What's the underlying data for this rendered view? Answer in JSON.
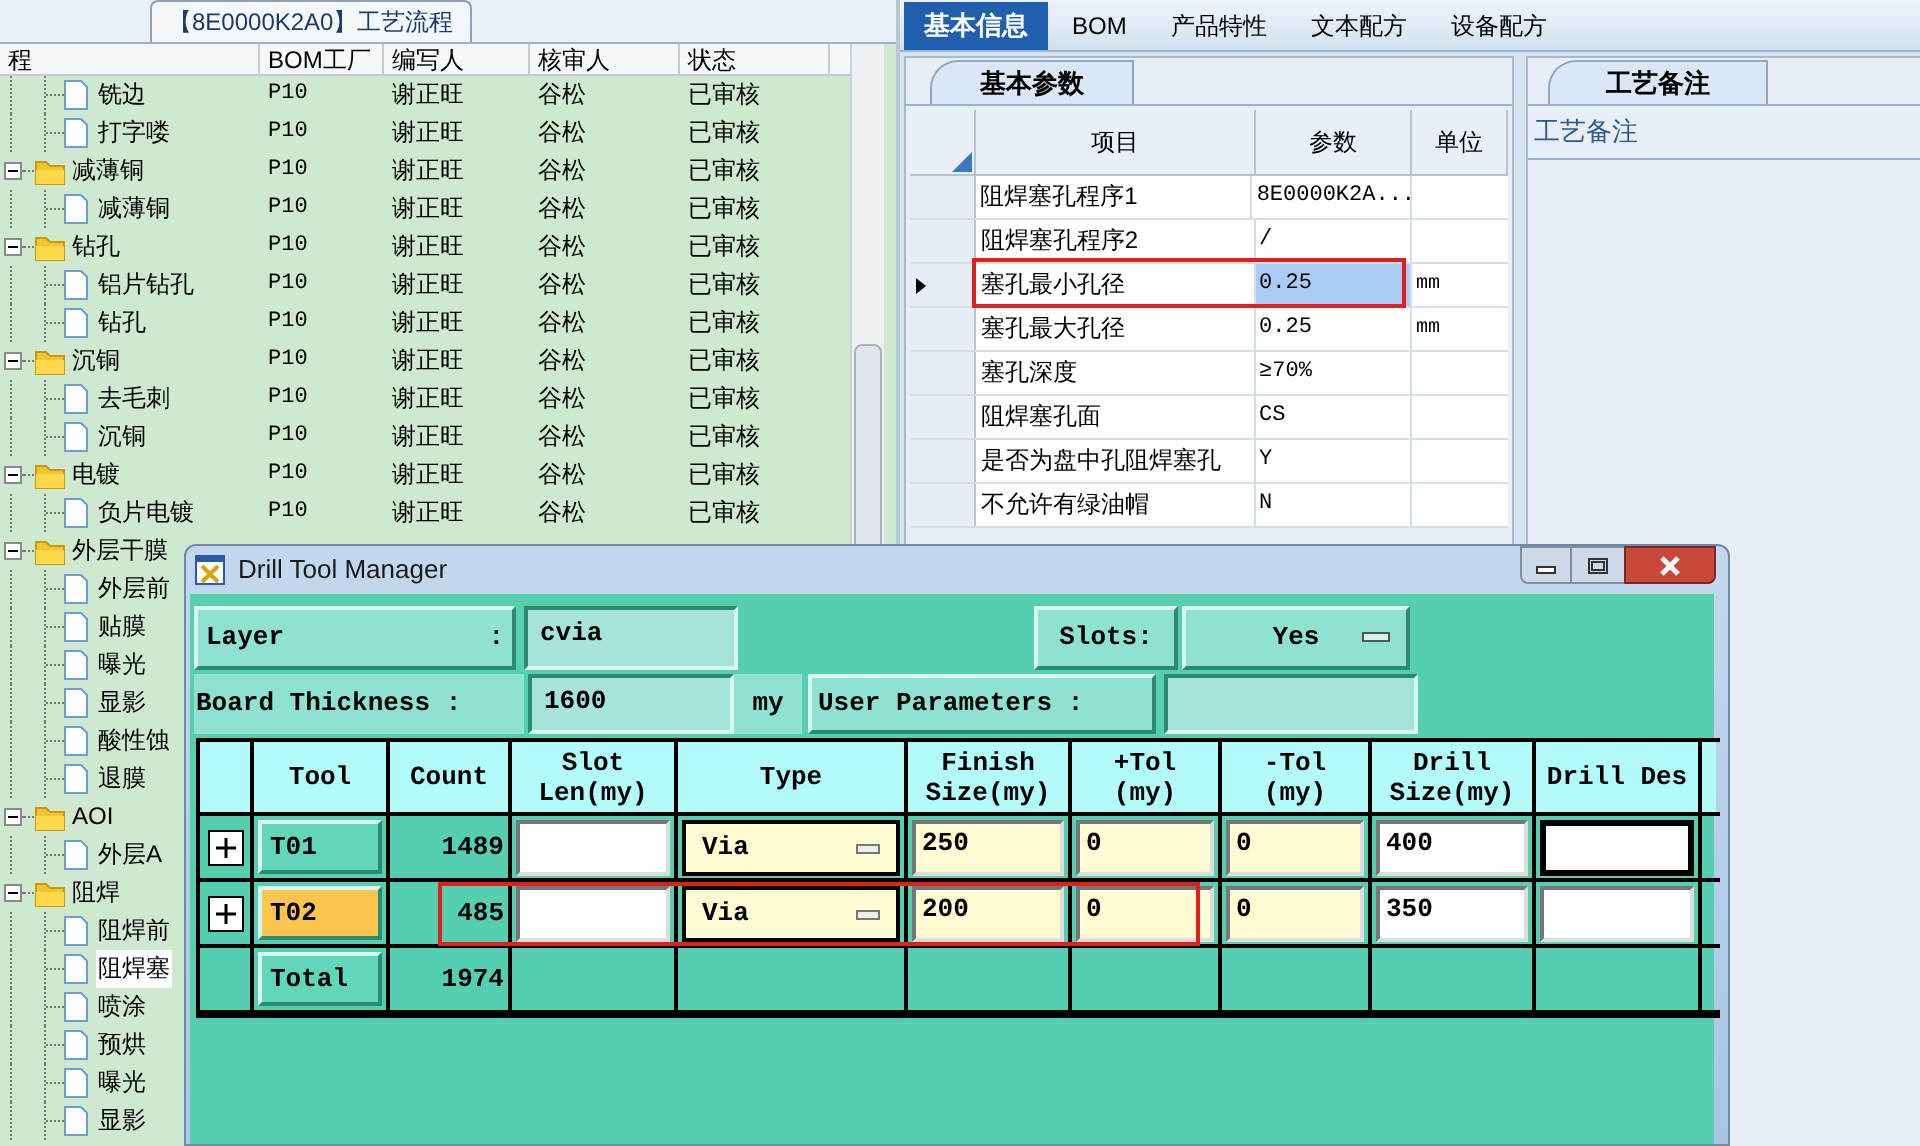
{
  "left_panel": {
    "tab": "【8E0000K2A0】工艺流程",
    "columns": [
      "程",
      "BOM工厂",
      "编写人",
      "核审人",
      "状态"
    ],
    "tree": [
      {
        "children": [
          {
            "name": "铣边",
            "bom": "P10",
            "writer": "谢正旺",
            "reviewer": "谷松",
            "status": "已审核",
            "selected": false
          },
          {
            "name": "打字喽",
            "bom": "P10",
            "writer": "谢正旺",
            "reviewer": "谷松",
            "status": "已审核",
            "selected": false
          }
        ]
      },
      {
        "name": "减薄铜",
        "bom": "P10",
        "writer": "谢正旺",
        "reviewer": "谷松",
        "status": "已审核",
        "selected": false,
        "expanded": true,
        "children": [
          {
            "name": "减薄铜",
            "bom": "P10",
            "writer": "谢正旺",
            "reviewer": "谷松",
            "status": "已审核",
            "selected": false
          }
        ]
      },
      {
        "name": "钻孔",
        "bom": "P10",
        "writer": "谢正旺",
        "reviewer": "谷松",
        "status": "已审核",
        "selected": false,
        "expanded": true,
        "children": [
          {
            "name": "铝片钻孔",
            "bom": "P10",
            "writer": "谢正旺",
            "reviewer": "谷松",
            "status": "已审核",
            "selected": false
          },
          {
            "name": "钻孔",
            "bom": "P10",
            "writer": "谢正旺",
            "reviewer": "谷松",
            "status": "已审核",
            "selected": false
          }
        ]
      },
      {
        "name": "沉铜",
        "bom": "P10",
        "writer": "谢正旺",
        "reviewer": "谷松",
        "status": "已审核",
        "selected": false,
        "expanded": true,
        "children": [
          {
            "name": "去毛刺",
            "bom": "P10",
            "writer": "谢正旺",
            "reviewer": "谷松",
            "status": "已审核",
            "selected": false
          },
          {
            "name": "沉铜",
            "bom": "P10",
            "writer": "谢正旺",
            "reviewer": "谷松",
            "status": "已审核",
            "selected": false
          }
        ]
      },
      {
        "name": "电镀",
        "bom": "P10",
        "writer": "谢正旺",
        "reviewer": "谷松",
        "status": "已审核",
        "selected": false,
        "expanded": true,
        "children": [
          {
            "name": "负片电镀",
            "bom": "P10",
            "writer": "谢正旺",
            "reviewer": "谷松",
            "status": "已审核",
            "selected": false
          }
        ]
      },
      {
        "name": "外层干膜",
        "selected": false,
        "expanded": true,
        "children": [
          {
            "name": "外层前",
            "selected": false
          },
          {
            "name": "贴膜",
            "selected": false
          },
          {
            "name": "曝光",
            "selected": false
          },
          {
            "name": "显影",
            "selected": false
          },
          {
            "name": "酸性蚀",
            "selected": false
          },
          {
            "name": "退膜",
            "selected": false
          }
        ]
      },
      {
        "name": "AOI",
        "selected": false,
        "expanded": true,
        "children": [
          {
            "name": "外层A",
            "selected": false
          }
        ]
      },
      {
        "name": "阻焊",
        "selected": false,
        "expanded": true,
        "children": [
          {
            "name": "阻焊前",
            "selected": false
          },
          {
            "name": "阻焊塞",
            "selected": true
          },
          {
            "name": "喷涂",
            "selected": false
          },
          {
            "name": "预烘",
            "selected": false
          },
          {
            "name": "曝光",
            "selected": false
          },
          {
            "name": "显影",
            "selected": false
          }
        ]
      }
    ]
  },
  "right_panel": {
    "tabs": [
      {
        "label": "基本信息",
        "selected": true
      },
      {
        "label": "BOM",
        "selected": false
      },
      {
        "label": "产品特性",
        "selected": false
      },
      {
        "label": "文本配方",
        "selected": false
      },
      {
        "label": "设备配方",
        "selected": false
      }
    ],
    "params_tab": "基本参数",
    "params_columns": [
      "项目",
      "参数",
      "单位"
    ],
    "params": [
      {
        "item": "阻焊塞孔程序1",
        "value": "8E0000K2A...",
        "current": false,
        "highlighted": false
      },
      {
        "item": "阻焊塞孔程序2",
        "value": "/",
        "current": false,
        "highlighted": false
      },
      {
        "item": "塞孔最小孔径",
        "value": "0.25",
        "unit": "mm",
        "current": true,
        "highlighted": true
      },
      {
        "item": "塞孔最大孔径",
        "value": "0.25",
        "unit": "mm",
        "current": false,
        "highlighted": false
      },
      {
        "item": "塞孔深度",
        "value": "≥70%",
        "current": false,
        "highlighted": false
      },
      {
        "item": "阻焊塞孔面",
        "value": "CS",
        "current": false,
        "highlighted": false
      },
      {
        "item": "是否为盘中孔阻焊塞孔",
        "value": "Y",
        "current": false,
        "highlighted": false
      },
      {
        "item": "不允许有绿油帽",
        "value": "N",
        "current": false,
        "highlighted": false
      }
    ],
    "notes_tab": "工艺备注",
    "notes_header": "工艺备注"
  },
  "dialog": {
    "title": "Drill Tool Manager",
    "layer_label": "Layer",
    "layer_colon": ":",
    "layer": "cvia",
    "slots_label": "Slots:",
    "slots": "Yes",
    "thickness_label": "Board Thickness :",
    "thickness": "1600",
    "thickness_unit": "my",
    "user_params_label": "User Parameters :",
    "columns": [
      "Tool",
      "Count",
      "Slot Len(my)",
      "Type",
      "Finish Size(my)",
      "+Tol (my)",
      "-Tol (my)",
      "Drill Size(my)",
      "Drill Des"
    ],
    "rows": [
      {
        "tool": "T01",
        "selected": false,
        "expanded": false,
        "highlighted": false,
        "count": "1489",
        "type": "Via",
        "finish": "250",
        "plus_tol": "0",
        "minus_tol": "0",
        "drill": "400",
        "des_focused": true
      },
      {
        "tool": "T02",
        "selected": true,
        "expanded": false,
        "highlighted": true,
        "count": "485",
        "type": "Via",
        "finish": "200",
        "plus_tol": "0",
        "minus_tol": "0",
        "drill": "350",
        "des_focused": false
      }
    ],
    "total": {
      "label": "Total",
      "count": "1974"
    }
  }
}
